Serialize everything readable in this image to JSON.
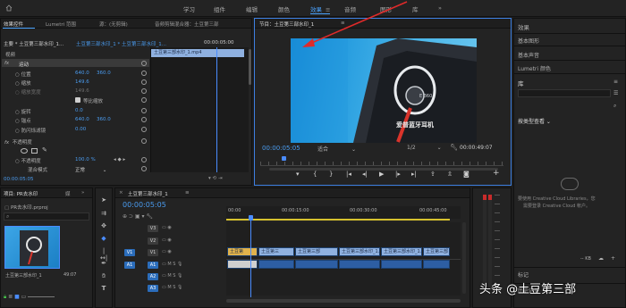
{
  "workspace_tabs": [
    {
      "label": "学习",
      "active": false
    },
    {
      "label": "组件",
      "active": false
    },
    {
      "label": "编辑",
      "active": false
    },
    {
      "label": "颜色",
      "active": false
    },
    {
      "label": "效果",
      "active": true
    },
    {
      "label": "音频",
      "active": false
    },
    {
      "label": "图形",
      "active": false
    },
    {
      "label": "库",
      "active": false
    }
  ],
  "source_panel": {
    "tabs": [
      "效果控件",
      "Lumetri 范围",
      "源：(无剪辑)",
      "音频剪辑混合器：土豆第三部"
    ],
    "master_clip": "主要 * 土豆第三部水印_1...",
    "seq_clip": "土豆第三部水印_1 * 土豆第三部水印_1...",
    "time_label": "00:00:05:00",
    "clip_name": "土豆第三部水印_1.mp4",
    "video_header": "视频",
    "motion_label": "运动",
    "props": [
      {
        "name": "位置",
        "value": "640.0",
        "value2": "360.0",
        "disabled": false
      },
      {
        "name": "缩放",
        "value": "149.6",
        "value2": "",
        "disabled": false
      },
      {
        "name": "缩放宽度",
        "value": "149.6",
        "value2": "",
        "disabled": true
      },
      {
        "name": "等比缩放",
        "value": "",
        "value2": "",
        "disabled": false
      },
      {
        "name": "旋转",
        "value": "0.0",
        "value2": "",
        "disabled": false
      },
      {
        "name": "锚点",
        "value": "640.0",
        "value2": "360.0",
        "disabled": false
      },
      {
        "name": "防闪烁滤镜",
        "value": "0.00",
        "value2": "",
        "disabled": false
      }
    ],
    "opacity_header": "不透明度",
    "opacity_label": "不透明度",
    "opacity_value": "100.0 %",
    "blend_label": "混合模式",
    "blend_value": "正常",
    "bottom_time": "00:00:05:05"
  },
  "program_monitor": {
    "title": "节目：土豆第三部水印_1",
    "timecode": "00:00:05:05",
    "fit": "适合",
    "quality": "1/2",
    "duration": "00:00:49:07",
    "product_text": "爱普蓝牙耳机"
  },
  "effects_panel": {
    "header": "效果",
    "items": [
      "基本图形",
      "基本声音",
      "Lumetri 颜色"
    ],
    "library_tab": "库",
    "library_dropdown": "按类型查看",
    "cc_message_1": "要使用 Creative Cloud Libraries，您",
    "cc_message_2": "需要登录 Creative Cloud 帐户。",
    "size": "-- KB",
    "markers_label": "标记",
    "history_label": "历史记录"
  },
  "project_panel": {
    "tabs": [
      "项目: PR去水印",
      "媒"
    ],
    "project_file": "PR去水印.prproj",
    "search_placeholder": "",
    "item_name": "土豆第三部水印_1",
    "item_duration": "49:07"
  },
  "timeline": {
    "title": "土豆第三部水印_1",
    "timecode": "00:00:05:05",
    "ruler": [
      "00:00",
      "00:00:15:00",
      "00:00:30:00",
      "00:00:45:00"
    ],
    "tracks": [
      {
        "name": "V3",
        "kind": "video"
      },
      {
        "name": "V2",
        "kind": "video"
      },
      {
        "name": "V1",
        "kind": "video"
      },
      {
        "name": "A1",
        "kind": "audio"
      },
      {
        "name": "A2",
        "kind": "audio"
      },
      {
        "name": "A3",
        "kind": "audio"
      }
    ],
    "clips": [
      "土豆第",
      "土豆第三",
      "土豆第三部",
      "土豆第三部水印_1.mp",
      "土豆第三部水印_1.mp",
      "土豆第三部"
    ]
  },
  "watermark": "头条 @土豆第三部",
  "colors": {
    "accent": "#4aa3ff",
    "video_clip": "#8fb1e0",
    "audio_clip": "#2d5ea3",
    "arrow": "#e02a2a",
    "playhead": "#4a8cff"
  }
}
